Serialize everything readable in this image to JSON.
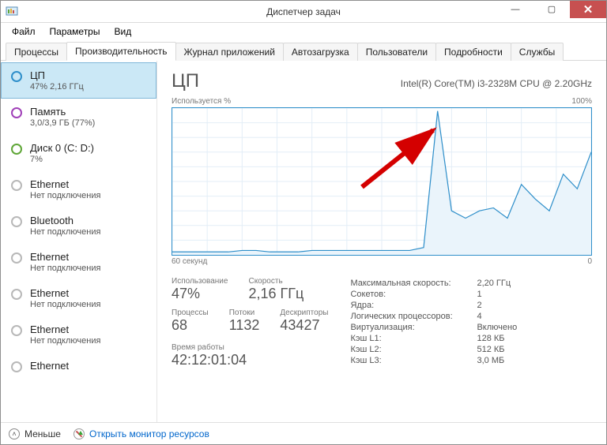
{
  "window": {
    "title": "Диспетчер задач"
  },
  "menu": {
    "file": "Файл",
    "options": "Параметры",
    "view": "Вид"
  },
  "tabs": {
    "processes": "Процессы",
    "performance": "Производительность",
    "apphistory": "Журнал приложений",
    "startup": "Автозагрузка",
    "users": "Пользователи",
    "details": "Подробности",
    "services": "Службы"
  },
  "sidebar": {
    "items": [
      {
        "title": "ЦП",
        "sub": "47% 2,16 ГГц",
        "color": "#2f8fca",
        "selected": true
      },
      {
        "title": "Память",
        "sub": "3,0/3,9 ГБ (77%)",
        "color": "#a040b8",
        "selected": false
      },
      {
        "title": "Диск 0 (C: D:)",
        "sub": "7%",
        "color": "#5fa637",
        "selected": false
      },
      {
        "title": "Ethernet",
        "sub": "Нет подключения",
        "color": "#b8b8b8",
        "selected": false
      },
      {
        "title": "Bluetooth",
        "sub": "Нет подключения",
        "color": "#b8b8b8",
        "selected": false
      },
      {
        "title": "Ethernet",
        "sub": "Нет подключения",
        "color": "#b8b8b8",
        "selected": false
      },
      {
        "title": "Ethernet",
        "sub": "Нет подключения",
        "color": "#b8b8b8",
        "selected": false
      },
      {
        "title": "Ethernet",
        "sub": "Нет подключения",
        "color": "#b8b8b8",
        "selected": false
      },
      {
        "title": "Ethernet",
        "sub": "",
        "color": "#b8b8b8",
        "selected": false
      }
    ]
  },
  "main": {
    "title": "ЦП",
    "cpu_model": "Intel(R) Core(TM) i3-2328M CPU @ 2.20GHz",
    "chart_ylabel": "Используется %",
    "chart_ymax": "100%",
    "chart_xleft": "60 секунд",
    "chart_xright": "0"
  },
  "stats": {
    "usage_lbl": "Использование",
    "usage_val": "47%",
    "speed_lbl": "Скорость",
    "speed_val": "2,16 ГГц",
    "procs_lbl": "Процессы",
    "procs_val": "68",
    "threads_lbl": "Потоки",
    "threads_val": "1132",
    "handles_lbl": "Дескрипторы",
    "handles_val": "43427",
    "uptime_lbl": "Время работы",
    "uptime_val": "42:12:01:04"
  },
  "details": {
    "maxspeed_lbl": "Максимальная скорость:",
    "maxspeed_val": "2,20 ГГц",
    "sockets_lbl": "Сокетов:",
    "sockets_val": "1",
    "cores_lbl": "Ядра:",
    "cores_val": "2",
    "logical_lbl": "Логических процессоров:",
    "logical_val": "4",
    "virt_lbl": "Виртуализация:",
    "virt_val": "Включено",
    "l1_lbl": "Кэш L1:",
    "l1_val": "128 КБ",
    "l2_lbl": "Кэш L2:",
    "l2_val": "512 КБ",
    "l3_lbl": "Кэш L3:",
    "l3_val": "3,0 МБ"
  },
  "footer": {
    "fewer": "Меньше",
    "resmon": "Открыть монитор ресурсов"
  },
  "chart_data": {
    "type": "line",
    "xlabel": "60 секунд → 0",
    "ylabel": "Используется %",
    "ylim": [
      0,
      100
    ],
    "x_seconds_ago": [
      60,
      58,
      56,
      54,
      52,
      50,
      48,
      46,
      44,
      42,
      40,
      38,
      36,
      34,
      32,
      30,
      28,
      26,
      24,
      22,
      20,
      18,
      16,
      14,
      12,
      10,
      8,
      6,
      4,
      2,
      0
    ],
    "values": [
      2,
      2,
      2,
      2,
      2,
      3,
      3,
      2,
      2,
      2,
      3,
      3,
      3,
      3,
      3,
      3,
      3,
      3,
      5,
      98,
      30,
      25,
      30,
      32,
      25,
      48,
      38,
      30,
      55,
      45,
      70
    ]
  }
}
